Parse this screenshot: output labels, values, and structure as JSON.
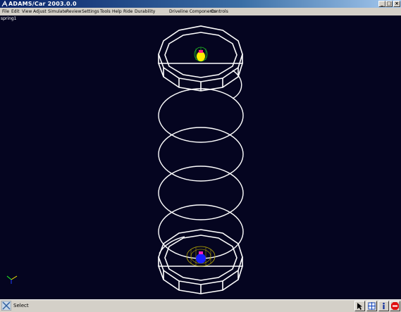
{
  "window": {
    "title": "ADAMS/Car 2003.0.0"
  },
  "menu": {
    "file": "File",
    "edit": "Edit",
    "view": "View",
    "adjust": "Adjust",
    "simulate": "Simulate",
    "review": "Review",
    "settings": "Settings",
    "tools": "Tools",
    "help": "Help",
    "ride": "Ride",
    "durability": "Durability",
    "driveline_components": "Driveline Components",
    "controls": "Controls"
  },
  "viewport": {
    "model_name": "spring1",
    "background_color": "#050520",
    "spring_color": "#ffffff"
  },
  "status": {
    "text": "Select"
  },
  "toolbar_icons": [
    "select-arrow-icon",
    "view-control-icon",
    "info-icon",
    "stop-icon"
  ]
}
